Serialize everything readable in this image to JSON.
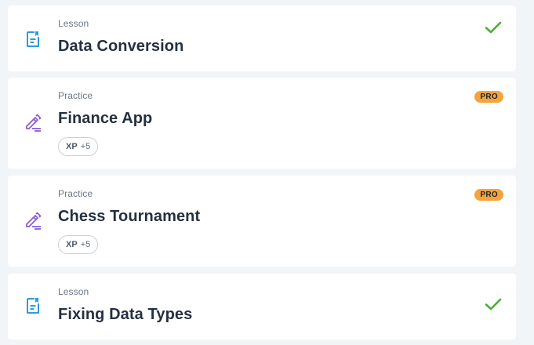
{
  "colors": {
    "page_bg": "#f2f5f8",
    "card_bg": "#ffffff",
    "lesson_icon": "#2d9cdb",
    "practice_icon": "#8a5cd6",
    "check": "#4caf33",
    "pro_badge": "#f5a33a",
    "title_text": "#253040",
    "type_text": "#6b7785"
  },
  "items": [
    {
      "type": "Lesson",
      "title": "Data Conversion",
      "icon": "lesson-document-icon",
      "completed": true
    },
    {
      "type": "Practice",
      "title": "Finance App",
      "icon": "practice-pencil-icon",
      "badge": "PRO",
      "xp_label": "XP",
      "xp_value": "+5"
    },
    {
      "type": "Practice",
      "title": "Chess Tournament",
      "icon": "practice-pencil-icon",
      "badge": "PRO",
      "xp_label": "XP",
      "xp_value": "+5"
    },
    {
      "type": "Lesson",
      "title": "Fixing Data Types",
      "icon": "lesson-document-icon",
      "completed": true
    }
  ]
}
